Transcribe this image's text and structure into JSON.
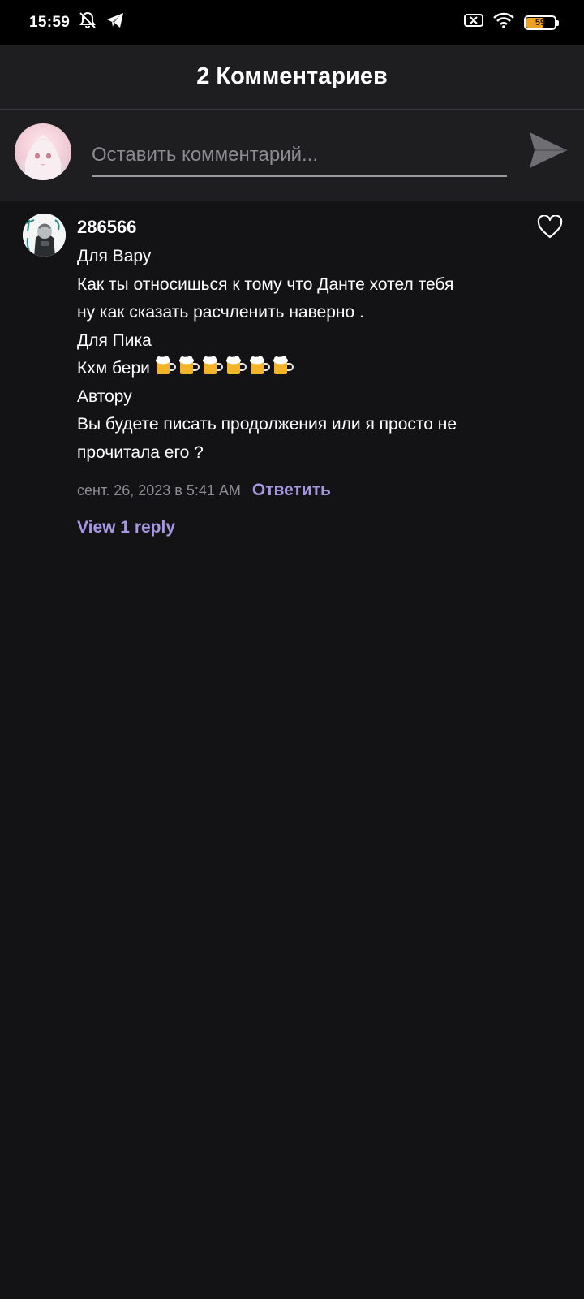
{
  "status_bar": {
    "time": "15:59",
    "battery_level": "59",
    "icons": [
      "alarm-off-icon",
      "telegram-icon",
      "sim-x-icon",
      "wifi-icon",
      "battery-icon"
    ]
  },
  "header": {
    "title": "2 Комментариев"
  },
  "composer": {
    "placeholder": "Оставить комментарий...",
    "value": "",
    "send_icon": "send-icon"
  },
  "comment": {
    "username": "286566",
    "lines": [
      "Для Вару",
      "Как ты относишься к тому что Данте хотел тебя",
      "ну как сказать расчленить наверно .",
      "Для Пика",
      "Кхм бери",
      "Автору",
      "Вы будете писать продолжения или я просто не",
      "прочитала его ?"
    ],
    "beer_emoji_count": 6,
    "timestamp": "сент. 26, 2023 в 5:41 AM",
    "reply_label": "Ответить",
    "view_replies_label": "View 1 reply",
    "liked": false
  },
  "colors": {
    "background": "#131215",
    "header_bg": "#1e1d20",
    "accent": "#a597e0",
    "muted_text": "#8e8d92"
  }
}
